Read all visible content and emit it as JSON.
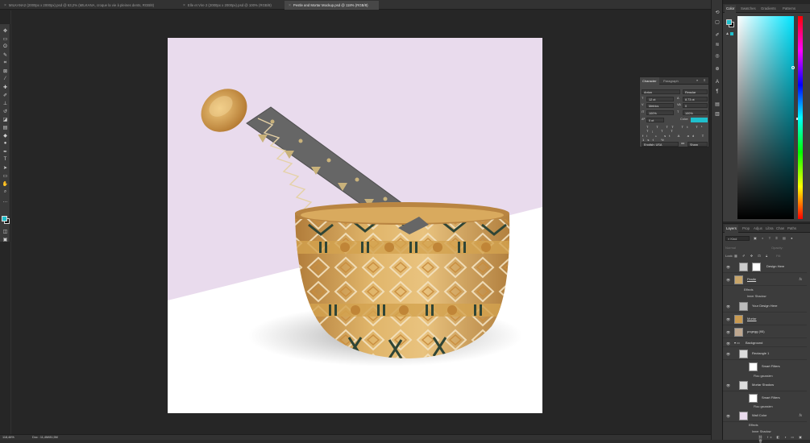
{
  "tabs": [
    {
      "label": "MILKANA2 (2000px x 2000px).psd @ 63,2% (MILKANA, croque la vie  à pleines dents, RGB/8)",
      "active": false
    },
    {
      "label": "Elle et Vire 2 (2000px x 2000px).psd @ 100% (RGB/8)",
      "active": false
    },
    {
      "label": "Pestle and Mortar Mockup.psd @ 118% (RGB/8)",
      "active": true
    }
  ],
  "status": {
    "zoom": "118,46%",
    "doc": "Doc : 11,4M/81,5M"
  },
  "color_panel": {
    "tabs": [
      "Color",
      "Swatches",
      "Gradients",
      "Patterns"
    ],
    "foreground": "#1fbfcc",
    "background": "#000000"
  },
  "character_panel": {
    "tabs": [
      "Character",
      "Paragraph"
    ],
    "font_family": "Anton",
    "font_style": "Regular",
    "font_size": "12 pt",
    "leading": "8,73 pt",
    "kerning": "Metrics",
    "tracking": "0",
    "vertical_scale": "100%",
    "horizontal_scale": "100%",
    "baseline_shift": "0 pt",
    "color_label": "Color:",
    "color": "#1fbfcc",
    "language": "English: USA",
    "antialias": "Sharp"
  },
  "layers_panel": {
    "tabs": [
      "Layers",
      "Prop",
      "Adjus",
      "Libra",
      "Chan",
      "Paths"
    ],
    "filter_label": "Kind",
    "blend_label": "Normal",
    "opacity_label": "Opacity:",
    "fill_label": "Fill:",
    "lock_label": "Lock:",
    "layers": [
      {
        "name": "Design Here",
        "type": "smart",
        "fx": false
      },
      {
        "name": "Pestle",
        "type": "image",
        "fx": true,
        "underline": true
      },
      {
        "name": "Effects",
        "type": "sub"
      },
      {
        "name": "Inner Shadow",
        "type": "sub2"
      },
      {
        "name": "Your Design Here",
        "type": "smart",
        "fx": false
      },
      {
        "name": "Mortar",
        "type": "image",
        "fx": false,
        "underline": true
      },
      {
        "name": "pngegg (95)",
        "type": "image",
        "fx": false
      },
      {
        "name": "Background",
        "type": "group"
      },
      {
        "name": "Rectangle 1",
        "type": "smart",
        "fx": false
      },
      {
        "name": "Smart Filters",
        "type": "sub2"
      },
      {
        "name": "Flou gaussien",
        "type": "sub3"
      },
      {
        "name": "Mortar Shadow",
        "type": "smart",
        "fx": false
      },
      {
        "name": "Smart Filters",
        "type": "sub2"
      },
      {
        "name": "Flou gaussien",
        "type": "sub3"
      },
      {
        "name": "Wall Color",
        "type": "color",
        "fx": true
      },
      {
        "name": "Effects",
        "type": "sub"
      },
      {
        "name": "Inner Shadow",
        "type": "sub2"
      }
    ]
  },
  "canvas": {
    "wall_color": "#e9dbed",
    "floor_color": "#ffffff"
  }
}
